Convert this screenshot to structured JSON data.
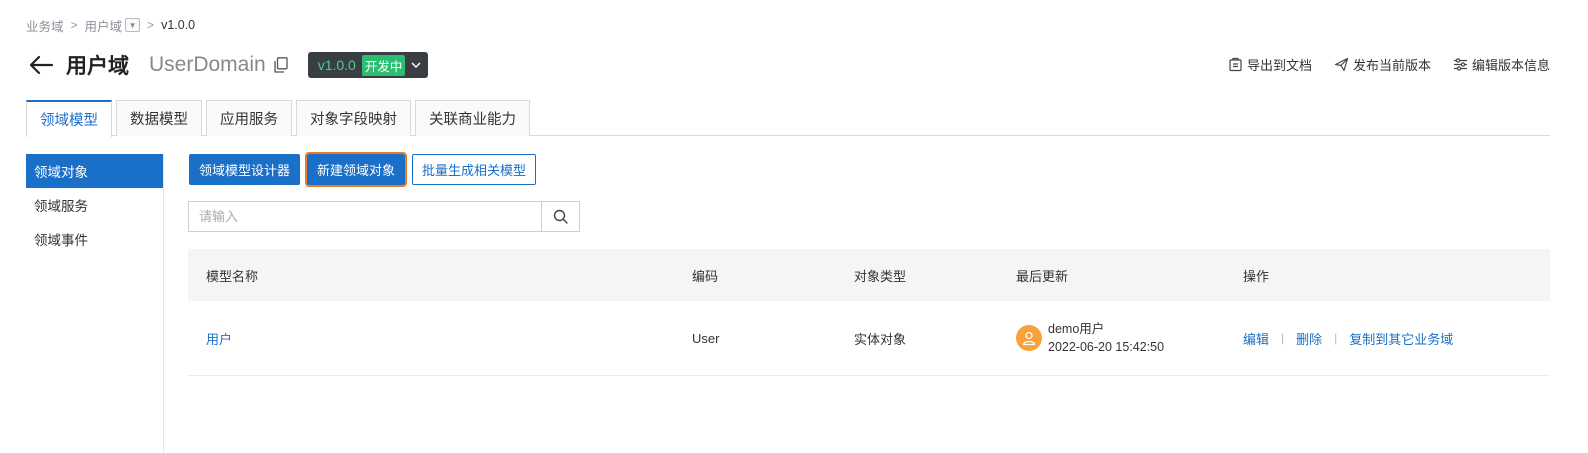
{
  "breadcrumb": {
    "items": [
      "业务域",
      "用户域",
      "v1.0.0"
    ],
    "separator": ">"
  },
  "header": {
    "title_cn": "用户域",
    "title_en": "UserDomain",
    "version": "v1.0.0",
    "status": "开发中",
    "actions": [
      "导出到文档",
      "发布当前版本",
      "编辑版本信息"
    ]
  },
  "tabs": [
    {
      "label": "领域模型",
      "active": true
    },
    {
      "label": "数据模型",
      "active": false
    },
    {
      "label": "应用服务",
      "active": false
    },
    {
      "label": "对象字段映射",
      "active": false
    },
    {
      "label": "关联商业能力",
      "active": false
    }
  ],
  "sidebar": {
    "items": [
      {
        "label": "领域对象",
        "active": true
      },
      {
        "label": "领域服务",
        "active": false
      },
      {
        "label": "领域事件",
        "active": false
      }
    ]
  },
  "toolbar": {
    "designer_label": "领域模型设计器",
    "new_label": "新建领域对象",
    "batch_label": "批量生成相关模型"
  },
  "search": {
    "placeholder": "请输入",
    "value": ""
  },
  "table": {
    "columns": [
      "模型名称",
      "编码",
      "对象类型",
      "最后更新",
      "操作"
    ],
    "rows": [
      {
        "name": "用户",
        "code": "User",
        "type": "实体对象",
        "updated_by": "demo用户",
        "updated_at": "2022-06-20 15:42:50",
        "ops": [
          "编辑",
          "删除",
          "复制到其它业务域"
        ]
      }
    ]
  },
  "colors": {
    "primary": "#1a6fc8",
    "status_green": "#2bbd72",
    "highlight": "#f07a1e",
    "avatar": "#f7a23a"
  }
}
